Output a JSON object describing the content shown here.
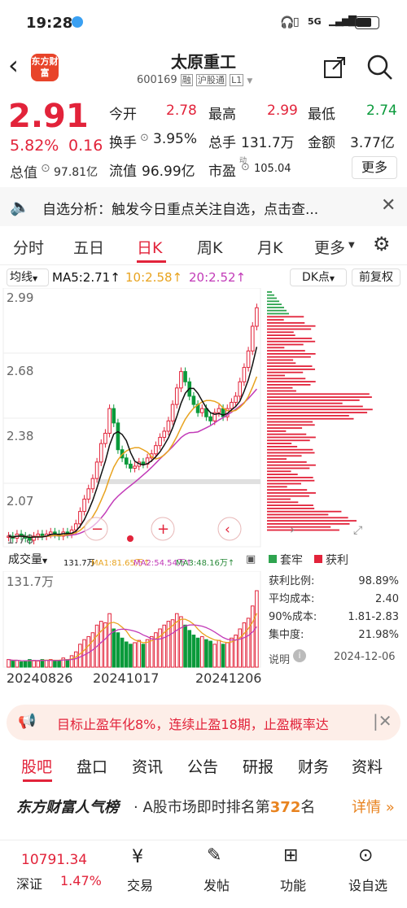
{
  "status": {
    "time": "19:28",
    "network": "5G",
    "battery": "69"
  },
  "header": {
    "logo_text": "东方财富",
    "title": "太原重工",
    "code": "600169",
    "tags": [
      "融",
      "沪股通",
      "L1"
    ]
  },
  "quote": {
    "price": "2.91",
    "change_pct": "5.82%",
    "change": "0.16",
    "total_cap_label": "总值",
    "total_cap": "97.81亿",
    "open_label": "今开",
    "open": "2.78",
    "high_label": "最高",
    "high": "2.99",
    "low_label": "最低",
    "low": "2.74",
    "turnover_label": "换手",
    "turnover": "3.95%",
    "volume_label": "总手",
    "volume": "131.7万",
    "amount_label": "金额",
    "amount": "3.77亿",
    "float_cap_label": "流值",
    "float_cap": "96.99亿",
    "pe_label": "市盈",
    "pe_sup": "动",
    "pe": "105.04",
    "more": "更多"
  },
  "banner": {
    "text": "自选分析：触发今日重点关注自选，点击查..."
  },
  "chart_tabs": [
    "分时",
    "五日",
    "日K",
    "周K",
    "月K",
    "更多"
  ],
  "active_tab": "日K",
  "chart_toolbar": {
    "ma_dropdown": "均线",
    "ma5": "MA5:2.71↑",
    "ma10": "10:2.58↑",
    "ma20": "20:2.52↑",
    "dk": "DK点",
    "adjust": "前复权"
  },
  "axis": {
    "price_ticks": [
      "2.99",
      "2.68",
      "2.38",
      "2.07",
      "1.78"
    ],
    "dates": [
      "20240826",
      "20241017",
      "20241206"
    ],
    "vol_max": "131.7万"
  },
  "volume_toolbar": {
    "label": "成交量",
    "vol": "131.7万",
    "ma1": "MA1:81.65万↑",
    "ma2": "MA2:54.54万↑",
    "ma3": "MA3:48.16万↑"
  },
  "chip": {
    "legend_trap": "套牢",
    "legend_profit": "获利",
    "rows": [
      {
        "label": "获利比例:",
        "value": "98.89%"
      },
      {
        "label": "平均成本:",
        "value": "2.40"
      },
      {
        "label": "90%成本:",
        "value": "1.81-2.83"
      },
      {
        "label": "集中度:",
        "value": "21.98%"
      }
    ],
    "note_label": "说明",
    "date": "2024-12-06"
  },
  "ad": {
    "text": "目标止盈年化8%，连续止盈18期，止盈概率达"
  },
  "bottom_tabs": [
    "股吧",
    "盘口",
    "资讯",
    "公告",
    "研报",
    "财务",
    "资料"
  ],
  "rank": {
    "brand": "东方财富人气榜",
    "text_pre": "· A股市场即时排名第",
    "rank": "372",
    "text_post": "名",
    "link": "详情"
  },
  "dock": {
    "index_value": "10791.34",
    "index_name": "深证",
    "index_change": "1.47%",
    "items": [
      "交易",
      "发帖",
      "功能",
      "设自选"
    ]
  },
  "colors": {
    "up": "#e2233a",
    "down": "#0a9a3b",
    "ma5": "#111111",
    "ma10": "#e8a31f",
    "ma20": "#c23bb8"
  }
}
